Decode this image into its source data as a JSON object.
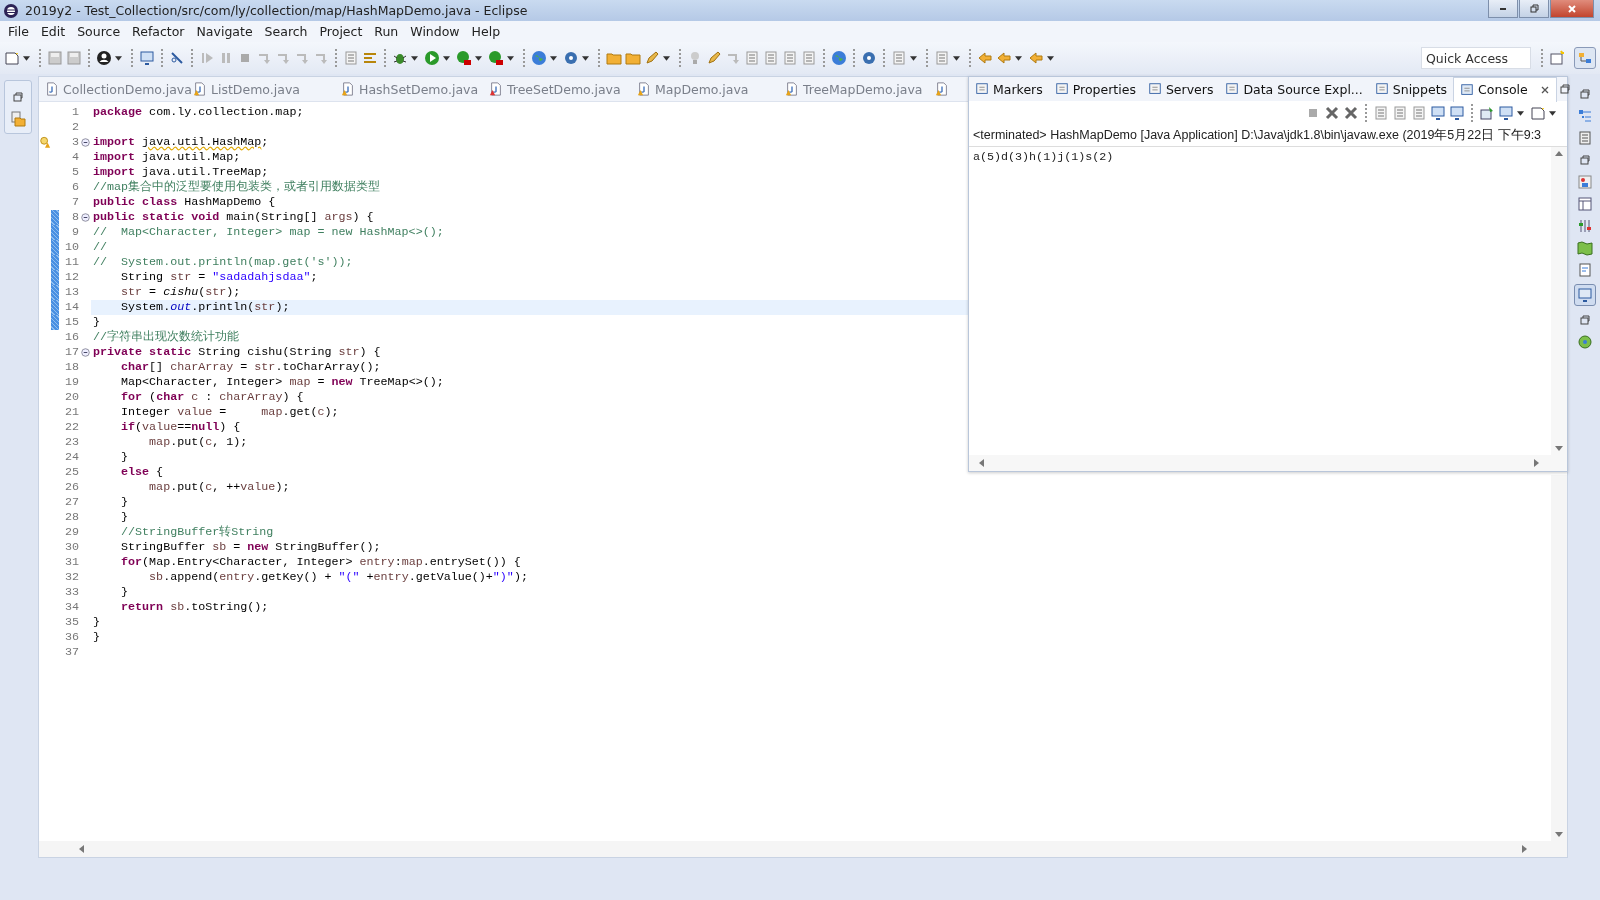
{
  "window": {
    "title": "2019y2 - Test_Collection/src/com/ly/collection/map/HashMapDemo.java - Eclipse"
  },
  "menu": [
    "File",
    "Edit",
    "Source",
    "Refactor",
    "Navigate",
    "Search",
    "Project",
    "Run",
    "Window",
    "Help"
  ],
  "quick_access": {
    "placeholder": "Quick Access"
  },
  "editor_tabs": [
    {
      "label": "CollectionDemo.java",
      "kind": "plain",
      "selected": false
    },
    {
      "label": "ListDemo.java",
      "kind": "warning",
      "selected": false
    },
    {
      "label": "HashSetDemo.java",
      "kind": "warning",
      "selected": false
    },
    {
      "label": "TreeSetDemo.java",
      "kind": "error",
      "selected": false
    },
    {
      "label": "MapDemo.java",
      "kind": "warning",
      "selected": false
    },
    {
      "label": "TreeMapDemo.java",
      "kind": "warning",
      "selected": false
    }
  ],
  "code_lines": [
    {
      "number": "1",
      "fold": false,
      "changed": false,
      "current": false,
      "warning": false,
      "tokens": [
        {
          "kind": "kw",
          "text": "package"
        },
        {
          "kind": "p",
          "text": " com.ly.collection.map;"
        }
      ]
    },
    {
      "number": "2",
      "fold": false,
      "changed": false,
      "current": false,
      "warning": false
    },
    {
      "number": "3",
      "fold": true,
      "changed": false,
      "current": false,
      "warning": true,
      "tokens": [
        {
          "kind": "kw",
          "text": "import "
        },
        {
          "kind": "w",
          "text": "java.util.HashMap"
        },
        {
          "kind": "p",
          "text": ";"
        }
      ]
    },
    {
      "number": "4",
      "fold": false,
      "changed": false,
      "current": false,
      "warning": false,
      "tokens": [
        {
          "kind": "kw",
          "text": "import"
        },
        {
          "kind": "p",
          "text": " java.util.Map;"
        }
      ]
    },
    {
      "number": "5",
      "fold": false,
      "changed": false,
      "current": false,
      "warning": false,
      "tokens": [
        {
          "kind": "kw",
          "text": "import"
        },
        {
          "kind": "p",
          "text": " java.util.TreeMap;"
        }
      ]
    },
    {
      "number": "6",
      "fold": false,
      "changed": false,
      "current": false,
      "warning": false,
      "tokens": [
        {
          "kind": "c",
          "text": "//map集合中的泛型要使用包装类，或者引用数据类型"
        }
      ]
    },
    {
      "number": "7",
      "fold": false,
      "changed": false,
      "current": false,
      "warning": false,
      "tokens": [
        {
          "kind": "kw",
          "text": "public class"
        },
        {
          "kind": "p",
          "text": " HashMapDemo {"
        }
      ]
    },
    {
      "number": "8",
      "fold": true,
      "changed": true,
      "current": false,
      "warning": false,
      "tokens": [
        {
          "kind": "kw",
          "text": "public static void"
        },
        {
          "kind": "p",
          "text": " main(String[] "
        },
        {
          "kind": "v",
          "text": "args"
        },
        {
          "kind": "p",
          "text": ") {"
        }
      ]
    },
    {
      "number": "9",
      "fold": false,
      "changed": true,
      "current": false,
      "warning": false,
      "tokens": [
        {
          "kind": "c",
          "text": "//  Map<Character, Integer> map = new HashMap<>();"
        }
      ]
    },
    {
      "number": "10",
      "fold": false,
      "changed": true,
      "current": false,
      "warning": false,
      "tokens": [
        {
          "kind": "c",
          "text": "//"
        }
      ]
    },
    {
      "number": "11",
      "fold": false,
      "changed": true,
      "current": false,
      "warning": false,
      "tokens": [
        {
          "kind": "c",
          "text": "//  System.out.println(map.get('s'));"
        }
      ]
    },
    {
      "number": "12",
      "fold": false,
      "changed": true,
      "current": false,
      "warning": false,
      "tokens": [
        {
          "kind": "p",
          "text": "    String "
        },
        {
          "kind": "v",
          "text": "str"
        },
        {
          "kind": "p",
          "text": " = "
        },
        {
          "kind": "s",
          "text": "\"sadadahjsdaa\""
        },
        {
          "kind": "p",
          "text": ";"
        }
      ]
    },
    {
      "number": "13",
      "fold": false,
      "changed": true,
      "current": false,
      "warning": false,
      "tokens": [
        {
          "kind": "v",
          "text": "    str"
        },
        {
          "kind": "p",
          "text": " = "
        },
        {
          "kind": "m",
          "text": "cishu"
        },
        {
          "kind": "p",
          "text": "("
        },
        {
          "kind": "v",
          "text": "str"
        },
        {
          "kind": "p",
          "text": ");"
        }
      ]
    },
    {
      "number": "14",
      "fold": false,
      "changed": true,
      "current": true,
      "warning": false,
      "tokens": [
        {
          "kind": "p",
          "text": "    System."
        },
        {
          "kind": "f",
          "text": "out"
        },
        {
          "kind": "p",
          "text": ".println("
        },
        {
          "kind": "v",
          "text": "str"
        },
        {
          "kind": "p",
          "text": ");"
        }
      ]
    },
    {
      "number": "15",
      "fold": false,
      "changed": true,
      "current": false,
      "warning": false,
      "tokens": [
        {
          "kind": "p",
          "text": "}"
        }
      ]
    },
    {
      "number": "16",
      "fold": false,
      "changed": false,
      "current": false,
      "warning": false,
      "tokens": [
        {
          "kind": "c",
          "text": "//字符串出现次数统计功能"
        }
      ]
    },
    {
      "number": "17",
      "fold": true,
      "changed": false,
      "current": false,
      "warning": false,
      "tokens": [
        {
          "kind": "kw",
          "text": "private static"
        },
        {
          "kind": "p",
          "text": " String cishu(String "
        },
        {
          "kind": "v",
          "text": "str"
        },
        {
          "kind": "p",
          "text": ") {"
        }
      ]
    },
    {
      "number": "18",
      "fold": false,
      "changed": false,
      "current": false,
      "warning": false,
      "tokens": [
        {
          "kind": "kw",
          "text": "    char"
        },
        {
          "kind": "p",
          "text": "[] "
        },
        {
          "kind": "v",
          "text": "charArray"
        },
        {
          "kind": "p",
          "text": " = "
        },
        {
          "kind": "v",
          "text": "str"
        },
        {
          "kind": "p",
          "text": ".toCharArray();"
        }
      ]
    },
    {
      "number": "19",
      "fold": false,
      "changed": false,
      "current": false,
      "warning": false,
      "tokens": [
        {
          "kind": "p",
          "text": "    Map<Character, Integer> "
        },
        {
          "kind": "v",
          "text": "map"
        },
        {
          "kind": "p",
          "text": " = "
        },
        {
          "kind": "kw",
          "text": "new"
        },
        {
          "kind": "p",
          "text": " TreeMap<>();"
        }
      ]
    },
    {
      "number": "20",
      "fold": false,
      "changed": false,
      "current": false,
      "warning": false,
      "tokens": [
        {
          "kind": "kw",
          "text": "    for"
        },
        {
          "kind": "p",
          "text": " ("
        },
        {
          "kind": "kw",
          "text": "char "
        },
        {
          "kind": "v",
          "text": "c"
        },
        {
          "kind": "p",
          "text": " : "
        },
        {
          "kind": "v",
          "text": "charArray"
        },
        {
          "kind": "p",
          "text": ") {"
        }
      ]
    },
    {
      "number": "21",
      "fold": false,
      "changed": false,
      "current": false,
      "warning": false,
      "tokens": [
        {
          "kind": "p",
          "text": "    Integer "
        },
        {
          "kind": "v",
          "text": "value"
        },
        {
          "kind": "p",
          "text": " =     "
        },
        {
          "kind": "v",
          "text": "map"
        },
        {
          "kind": "p",
          "text": ".get("
        },
        {
          "kind": "v",
          "text": "c"
        },
        {
          "kind": "p",
          "text": ");"
        }
      ]
    },
    {
      "number": "22",
      "fold": false,
      "changed": false,
      "current": false,
      "warning": false,
      "tokens": [
        {
          "kind": "kw",
          "text": "    if"
        },
        {
          "kind": "p",
          "text": "("
        },
        {
          "kind": "v",
          "text": "value"
        },
        {
          "kind": "p",
          "text": "=="
        },
        {
          "kind": "kw",
          "text": "null"
        },
        {
          "kind": "p",
          "text": ") {"
        }
      ]
    },
    {
      "number": "23",
      "fold": false,
      "changed": false,
      "current": false,
      "warning": false,
      "tokens": [
        {
          "kind": "v",
          "text": "        map"
        },
        {
          "kind": "p",
          "text": ".put("
        },
        {
          "kind": "v",
          "text": "c"
        },
        {
          "kind": "p",
          "text": ", 1);"
        }
      ]
    },
    {
      "number": "24",
      "fold": false,
      "changed": false,
      "current": false,
      "warning": false,
      "tokens": [
        {
          "kind": "p",
          "text": "    }"
        }
      ]
    },
    {
      "number": "25",
      "fold": false,
      "changed": false,
      "current": false,
      "warning": false,
      "tokens": [
        {
          "kind": "kw",
          "text": "    else"
        },
        {
          "kind": "p",
          "text": " {"
        }
      ]
    },
    {
      "number": "26",
      "fold": false,
      "changed": false,
      "current": false,
      "warning": false,
      "tokens": [
        {
          "kind": "v",
          "text": "        map"
        },
        {
          "kind": "p",
          "text": ".put("
        },
        {
          "kind": "v",
          "text": "c"
        },
        {
          "kind": "p",
          "text": ", ++"
        },
        {
          "kind": "v",
          "text": "value"
        },
        {
          "kind": "p",
          "text": ");"
        }
      ]
    },
    {
      "number": "27",
      "fold": false,
      "changed": false,
      "current": false,
      "warning": false,
      "tokens": [
        {
          "kind": "p",
          "text": "    }"
        }
      ]
    },
    {
      "number": "28",
      "fold": false,
      "changed": false,
      "current": false,
      "warning": false,
      "tokens": [
        {
          "kind": "p",
          "text": "    }"
        }
      ]
    },
    {
      "number": "29",
      "fold": false,
      "changed": false,
      "current": false,
      "warning": false,
      "tokens": [
        {
          "kind": "c",
          "text": "    //StringBuffer转String"
        }
      ]
    },
    {
      "number": "30",
      "fold": false,
      "changed": false,
      "current": false,
      "warning": false,
      "tokens": [
        {
          "kind": "p",
          "text": "    StringBuffer "
        },
        {
          "kind": "v",
          "text": "sb"
        },
        {
          "kind": "p",
          "text": " = "
        },
        {
          "kind": "kw",
          "text": "new"
        },
        {
          "kind": "p",
          "text": " StringBuffer();"
        }
      ]
    },
    {
      "number": "31",
      "fold": false,
      "changed": false,
      "current": false,
      "warning": false,
      "tokens": [
        {
          "kind": "kw",
          "text": "    for"
        },
        {
          "kind": "p",
          "text": "(Map.Entry<Character, Integer> "
        },
        {
          "kind": "v",
          "text": "entry"
        },
        {
          "kind": "p",
          "text": ":"
        },
        {
          "kind": "v",
          "text": "map"
        },
        {
          "kind": "p",
          "text": ".entrySet()) {"
        }
      ]
    },
    {
      "number": "32",
      "fold": false,
      "changed": false,
      "current": false,
      "warning": false,
      "tokens": [
        {
          "kind": "v",
          "text": "        sb"
        },
        {
          "kind": "p",
          "text": ".append("
        },
        {
          "kind": "v",
          "text": "entry"
        },
        {
          "kind": "p",
          "text": ".getKey() + "
        },
        {
          "kind": "s",
          "text": "\"(\""
        },
        {
          "kind": "p",
          "text": " +"
        },
        {
          "kind": "v",
          "text": "entry"
        },
        {
          "kind": "p",
          "text": ".getValue()+"
        },
        {
          "kind": "s",
          "text": "\")\""
        },
        {
          "kind": "p",
          "text": ");"
        }
      ]
    },
    {
      "number": "33",
      "fold": false,
      "changed": false,
      "current": false,
      "warning": false,
      "tokens": [
        {
          "kind": "p",
          "text": "    }"
        }
      ]
    },
    {
      "number": "34",
      "fold": false,
      "changed": false,
      "current": false,
      "warning": false,
      "tokens": [
        {
          "kind": "kw",
          "text": "    return "
        },
        {
          "kind": "v",
          "text": "sb"
        },
        {
          "kind": "p",
          "text": ".toString();"
        }
      ]
    },
    {
      "number": "35",
      "fold": false,
      "changed": false,
      "current": false,
      "warning": false,
      "tokens": [
        {
          "kind": "p",
          "text": "}"
        }
      ]
    },
    {
      "number": "36",
      "fold": false,
      "changed": false,
      "current": false,
      "warning": false,
      "tokens": [
        {
          "kind": "p",
          "text": "}"
        }
      ]
    },
    {
      "number": "37",
      "fold": false,
      "changed": false,
      "current": false,
      "warning": false
    }
  ],
  "view_tabs": [
    {
      "label": "Markers",
      "selected": false
    },
    {
      "label": "Properties",
      "selected": false
    },
    {
      "label": "Servers",
      "selected": false
    },
    {
      "label": "Data Source Expl...",
      "selected": false
    },
    {
      "label": "Snippets",
      "selected": false
    },
    {
      "label": "Console",
      "selected": true
    }
  ],
  "console": {
    "header": "<terminated> HashMapDemo [Java Application] D:\\Java\\jdk1.8\\bin\\javaw.exe (2019年5月22日 下午9:3",
    "output": "a(5)d(3)h(1)j(1)s(2)"
  }
}
